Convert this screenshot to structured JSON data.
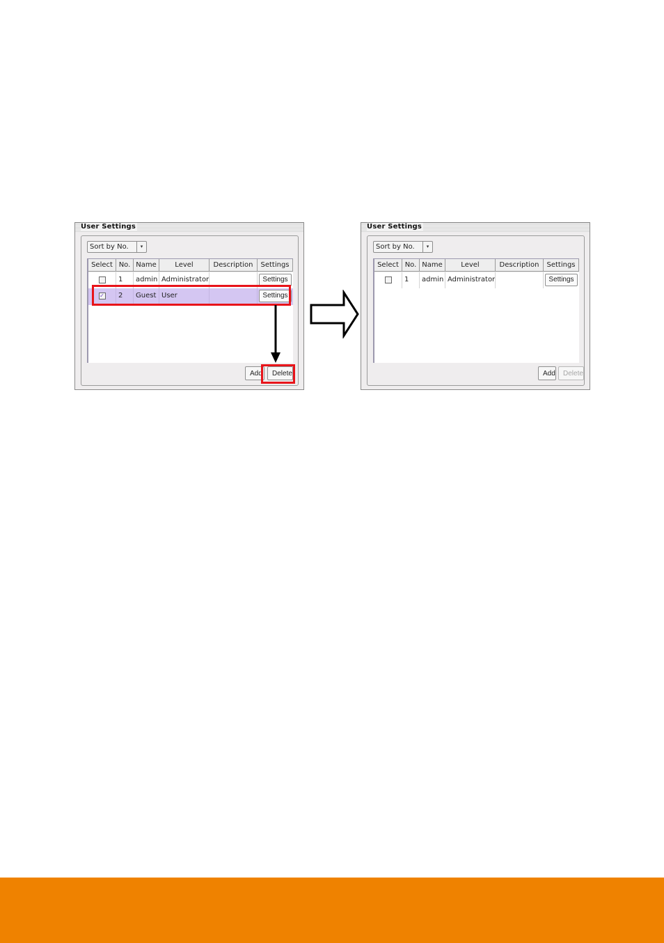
{
  "before_panel": {
    "title": "User Settings",
    "sort": {
      "selected": "Sort by No.",
      "arrow_icon": "▾"
    },
    "columns": [
      "Select",
      "No.",
      "Name",
      "Level",
      "Description",
      "Settings"
    ],
    "rows": [
      {
        "checked": false,
        "no": "1",
        "name": "admin",
        "level": "Administrator",
        "description": "",
        "settings_label": "Settings",
        "selected": false
      },
      {
        "checked": true,
        "no": "2",
        "name": "Guest",
        "level": "User",
        "description": "",
        "settings_label": "Settings",
        "selected": true
      }
    ],
    "add_label": "Add",
    "delete_label": "Delete",
    "check_glyph": "✓"
  },
  "after_panel": {
    "title": "User Settings",
    "sort": {
      "selected": "Sort by No.",
      "arrow_icon": "▾"
    },
    "columns": [
      "Select",
      "No.",
      "Name",
      "Level",
      "Description",
      "Settings"
    ],
    "rows": [
      {
        "checked": false,
        "no": "1",
        "name": "admin",
        "level": "Administrator",
        "description": "",
        "settings_label": "Settings",
        "selected": false
      }
    ],
    "add_label": "Add",
    "delete_label": "Delete",
    "delete_disabled": true
  },
  "annotations": {
    "highlight_color": "#e8141a",
    "transition_icon": "right-arrow-outline",
    "flow_icon": "down-arrow"
  },
  "footer": {
    "bar_color": "#ef8200"
  }
}
